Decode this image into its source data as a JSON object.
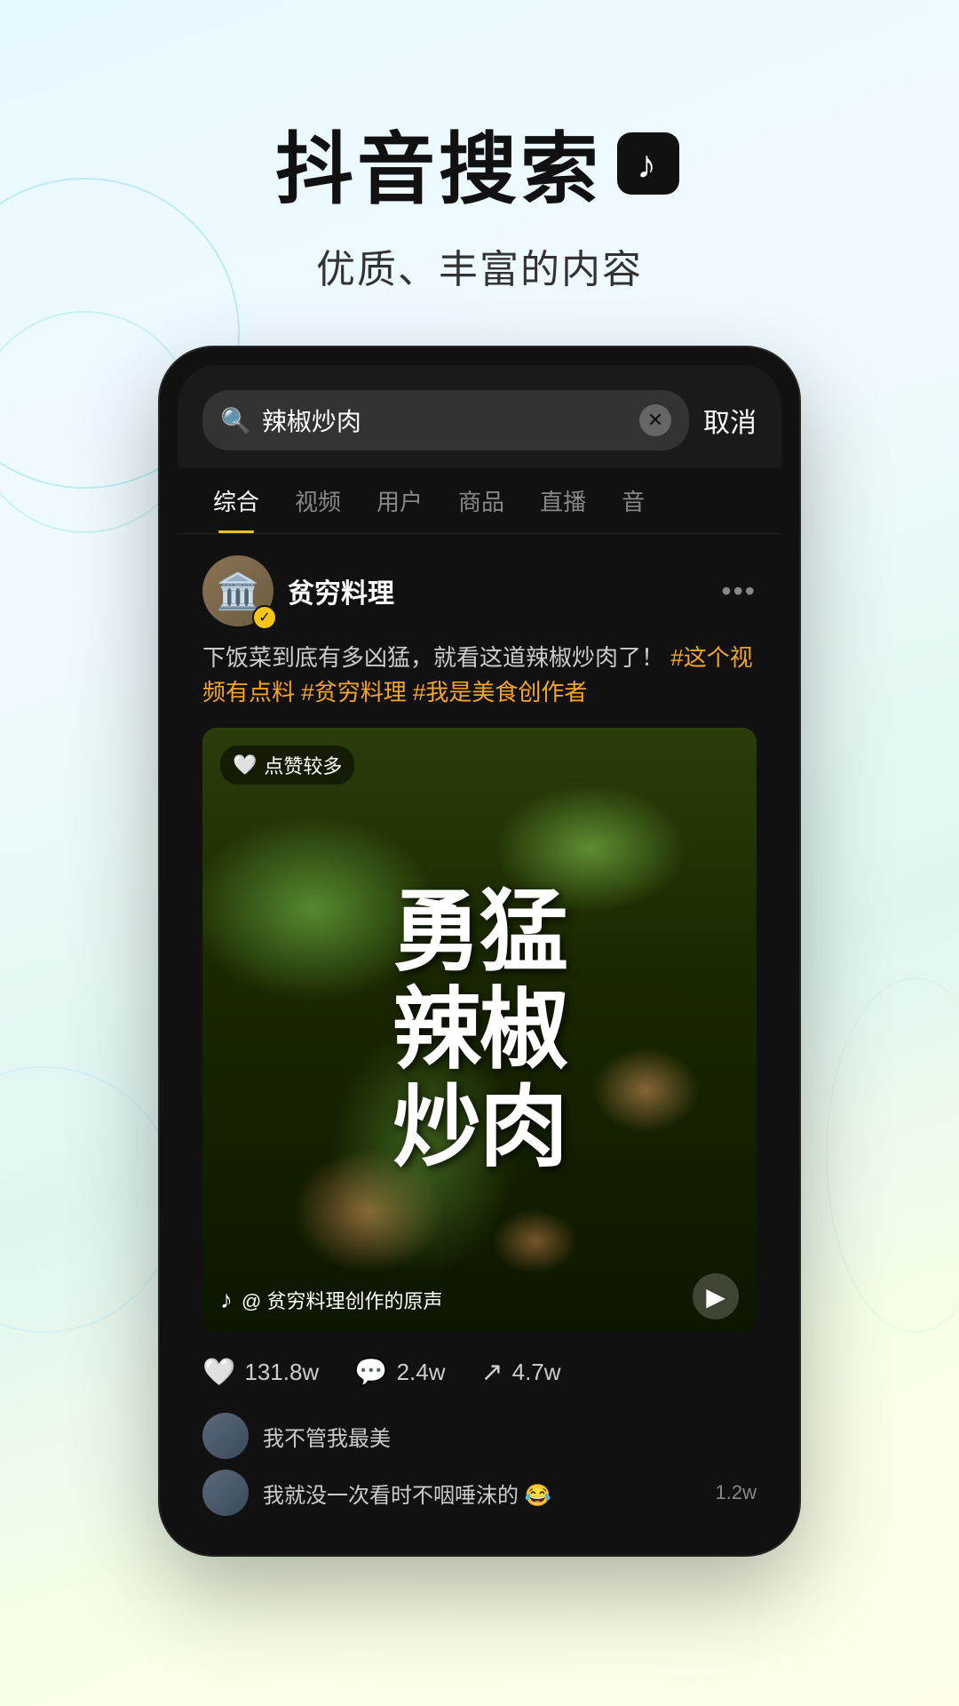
{
  "header": {
    "title": "抖音搜索",
    "tiktok_symbol": "♪",
    "subtitle": "优质、丰富的内容"
  },
  "phone": {
    "search_bar": {
      "query": "辣椒炒肉",
      "cancel_label": "取消"
    },
    "tabs": [
      {
        "label": "综合",
        "active": true
      },
      {
        "label": "视频",
        "active": false
      },
      {
        "label": "用户",
        "active": false
      },
      {
        "label": "商品",
        "active": false
      },
      {
        "label": "直播",
        "active": false
      },
      {
        "label": "音",
        "active": false
      }
    ],
    "post": {
      "user_name": "贫穷料理",
      "avatar_emoji": "🏛️",
      "verified": true,
      "text_plain": "下饭菜到底有多凶猛，就看这道辣椒炒肉了！",
      "hashtags": [
        "#这个视频有点料",
        "#贫穷料理",
        "#我是美食创作者"
      ],
      "likes_badge": "点赞较多",
      "video_overlay_text": "勇\n猛\n辣\n椒\n炒\n肉",
      "audio_text": "@ 贫穷料理创作的原声",
      "engagement": {
        "likes": "131.8w",
        "comments": "2.4w",
        "shares": "4.7w"
      },
      "comments": [
        {
          "text": "我不管我最美",
          "count": ""
        },
        {
          "text": "我就没一次看时不咽唾沫的 😂",
          "count": "1.2w"
        }
      ]
    }
  }
}
